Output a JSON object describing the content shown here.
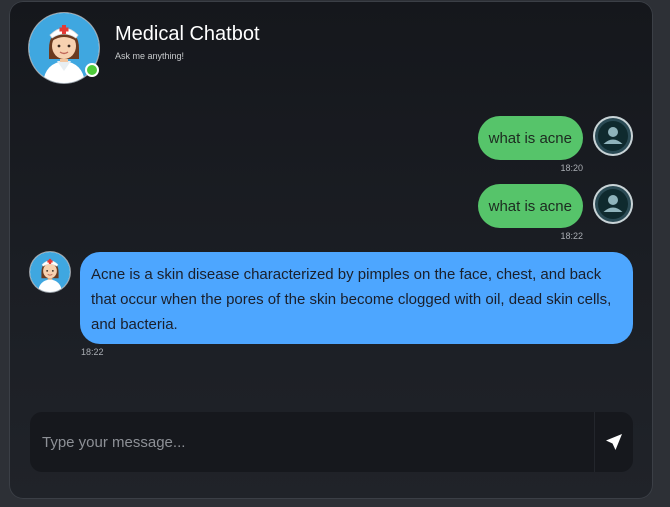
{
  "header": {
    "title": "Medical Chatbot",
    "subtitle": "Ask me anything!",
    "status": "online",
    "avatar_icon": "nurse-avatar-icon"
  },
  "messages": [
    {
      "sender": "user",
      "text": "what is acne",
      "time": "18:20"
    },
    {
      "sender": "user",
      "text": "what is acne",
      "time": "18:22"
    },
    {
      "sender": "bot",
      "text": "Acne is a skin disease characterized by pimples on the face, chest, and back that occur when the pores of the skin become clogged with oil, dead skin cells, and bacteria.",
      "time": "18:22"
    }
  ],
  "composer": {
    "placeholder": "Type your message...",
    "value": "",
    "send_icon": "send-icon"
  },
  "colors": {
    "user_bubble": "#56c46a",
    "bot_bubble": "#4da6ff",
    "online": "#4ecb3a"
  }
}
